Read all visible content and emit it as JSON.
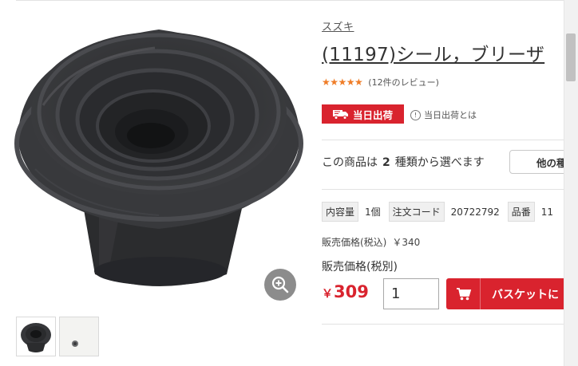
{
  "product": {
    "brand": "スズキ",
    "title": "(11197)シール，ブリーザ",
    "rating": 5,
    "rating_stars": "★★★★★",
    "review_count_text": "(12件のレビュー)"
  },
  "shipping": {
    "badge_label": "当日出荷",
    "help_text": "当日出荷とは",
    "badge_color": "#d9232e"
  },
  "variants": {
    "prefix": "この商品は",
    "count": "2",
    "suffix": "種類から選べます",
    "other_button_label": "他の種"
  },
  "specs": [
    {
      "label": "内容量",
      "value": "1個"
    },
    {
      "label": "注文コード",
      "value": "20722792"
    },
    {
      "label": "品番",
      "value": "11"
    }
  ],
  "pricing": {
    "tax_in_label": "販売価格(税込)",
    "tax_in_value": "￥340",
    "tax_ex_label": "販売価格(税別)",
    "yen_symbol": "￥",
    "price_value": "309",
    "accent_color": "#d9232e"
  },
  "cart": {
    "quantity": "1",
    "basket_label": "バスケットに"
  },
  "icons": {
    "zoom": "zoom-in-icon",
    "truck": "truck-icon",
    "info": "info-icon",
    "cart": "cart-icon"
  }
}
